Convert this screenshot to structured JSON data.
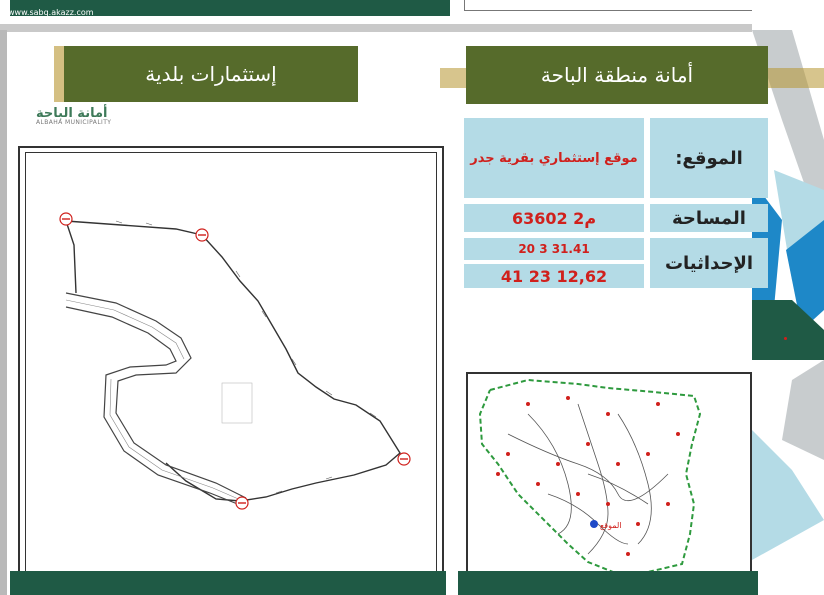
{
  "website": "www.sabq.akazz.com",
  "headers": {
    "left": "إستثمارات بلدية",
    "right": "أمانة منطقة الباحة"
  },
  "logo": {
    "arabic": "أمانة الباحة",
    "english": "ALBAHA MUNICIPALITY"
  },
  "info": {
    "location_label": ":الموقع",
    "location_value": "موقع إستثماري بقرية جدر",
    "area_label": "المساحة",
    "area_value": "63602 م2",
    "coords_label": "الإحداثيات",
    "coord_1": "20 3 31.41",
    "coord_2": "41 23 12,62"
  },
  "inset_map": {
    "location_label": "الموقع"
  },
  "colors": {
    "header_green": "#566b2b",
    "dark_green": "#1f5a45",
    "gold": "#b7952f",
    "cell_blue": "#b4dbe6",
    "value_red": "#d0201c"
  }
}
